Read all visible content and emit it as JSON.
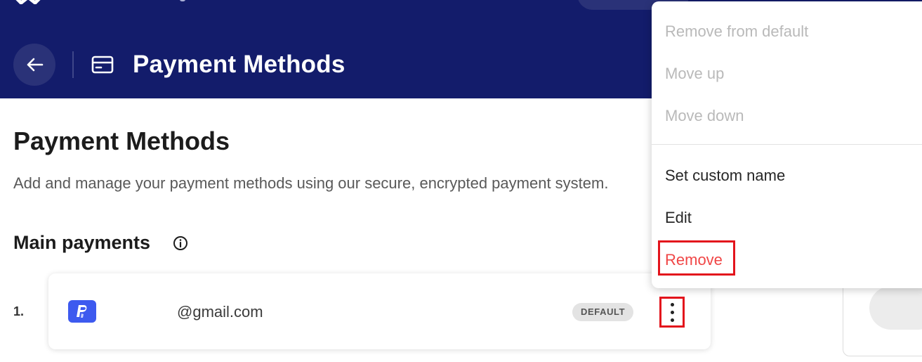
{
  "header": {
    "title": "Payment Methods",
    "back_icon": "arrow-left-icon",
    "section_icon": "credit-card-icon",
    "color": "#131c6b"
  },
  "main": {
    "title": "Payment Methods",
    "subtitle": "Add and manage your payment methods using our secure, encrypted payment system.",
    "section_title": "Main payments",
    "section_info_icon": "info-icon"
  },
  "payments": [
    {
      "index": "1.",
      "icon": "paypal-icon",
      "email": "@gmail.com",
      "badge": "DEFAULT",
      "menu_icon": "kebab-menu-icon"
    }
  ],
  "context_menu": {
    "disabled_items": [
      "Remove from default",
      "Move up",
      "Move down"
    ],
    "enabled_items": [
      "Set custom name",
      "Edit"
    ],
    "danger_item": "Remove",
    "danger_color": "#f04646"
  },
  "highlight_color": "#e3141c"
}
